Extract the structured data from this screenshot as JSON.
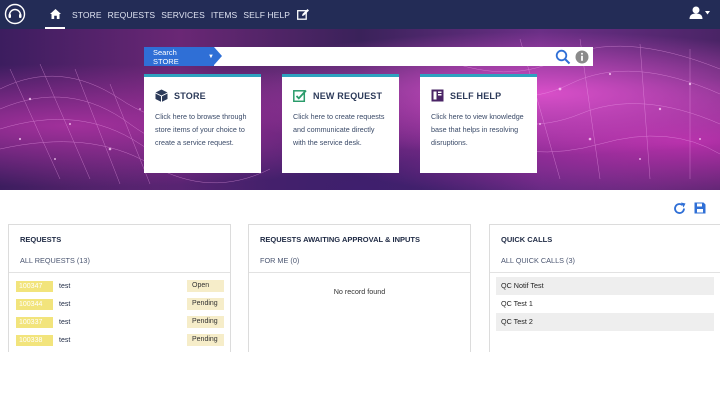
{
  "nav": {
    "items": [
      {
        "label": "STORE"
      },
      {
        "label": "REQUESTS"
      },
      {
        "label": "SERVICES"
      },
      {
        "label": "ITEMS"
      },
      {
        "label": "SELF HELP"
      }
    ]
  },
  "search": {
    "scope_label": "Search STORE",
    "value": "",
    "placeholder": ""
  },
  "cards": [
    {
      "title": "STORE",
      "desc": "Click here to browse through store items of your choice to create a service request."
    },
    {
      "title": "NEW REQUEST",
      "desc": "Click here to create requests and communicate directly with the service desk."
    },
    {
      "title": "SELF HELP",
      "desc": "Click here to view knowledge base that helps in resolving disruptions."
    }
  ],
  "panels": {
    "requests": {
      "title": "REQUESTS",
      "subtitle": "ALL REQUESTS (13)",
      "rows": [
        {
          "id": "100347",
          "name": "test",
          "status": "Open"
        },
        {
          "id": "100344",
          "name": "test",
          "status": "Pending"
        },
        {
          "id": "100337",
          "name": "test",
          "status": "Pending"
        },
        {
          "id": "100338",
          "name": "test",
          "status": "Pending"
        }
      ]
    },
    "approvals": {
      "title": "REQUESTS AWAITING APPROVAL & INPUTS",
      "subtitle": "FOR ME (0)",
      "empty_text": "No record found"
    },
    "quick_calls": {
      "title": "QUICK CALLS",
      "subtitle": "ALL QUICK CALLS (3)",
      "items": [
        {
          "label": "QC Notif Test"
        },
        {
          "label": "QC Test 1"
        },
        {
          "label": "QC Test 2"
        }
      ]
    }
  },
  "colors": {
    "topbar": "#232c56",
    "search_scope": "#2f6fd6",
    "card_accent": "#2ea3bf",
    "request_id_badge": "#f2e47c",
    "status_badge": "#f6edc9"
  },
  "icons": [
    "headset-logo-icon",
    "home-icon",
    "edit-icon",
    "user-icon",
    "search-icon",
    "info-icon",
    "store-box-icon",
    "new-request-icon",
    "self-help-book-icon",
    "refresh-icon",
    "save-icon"
  ]
}
